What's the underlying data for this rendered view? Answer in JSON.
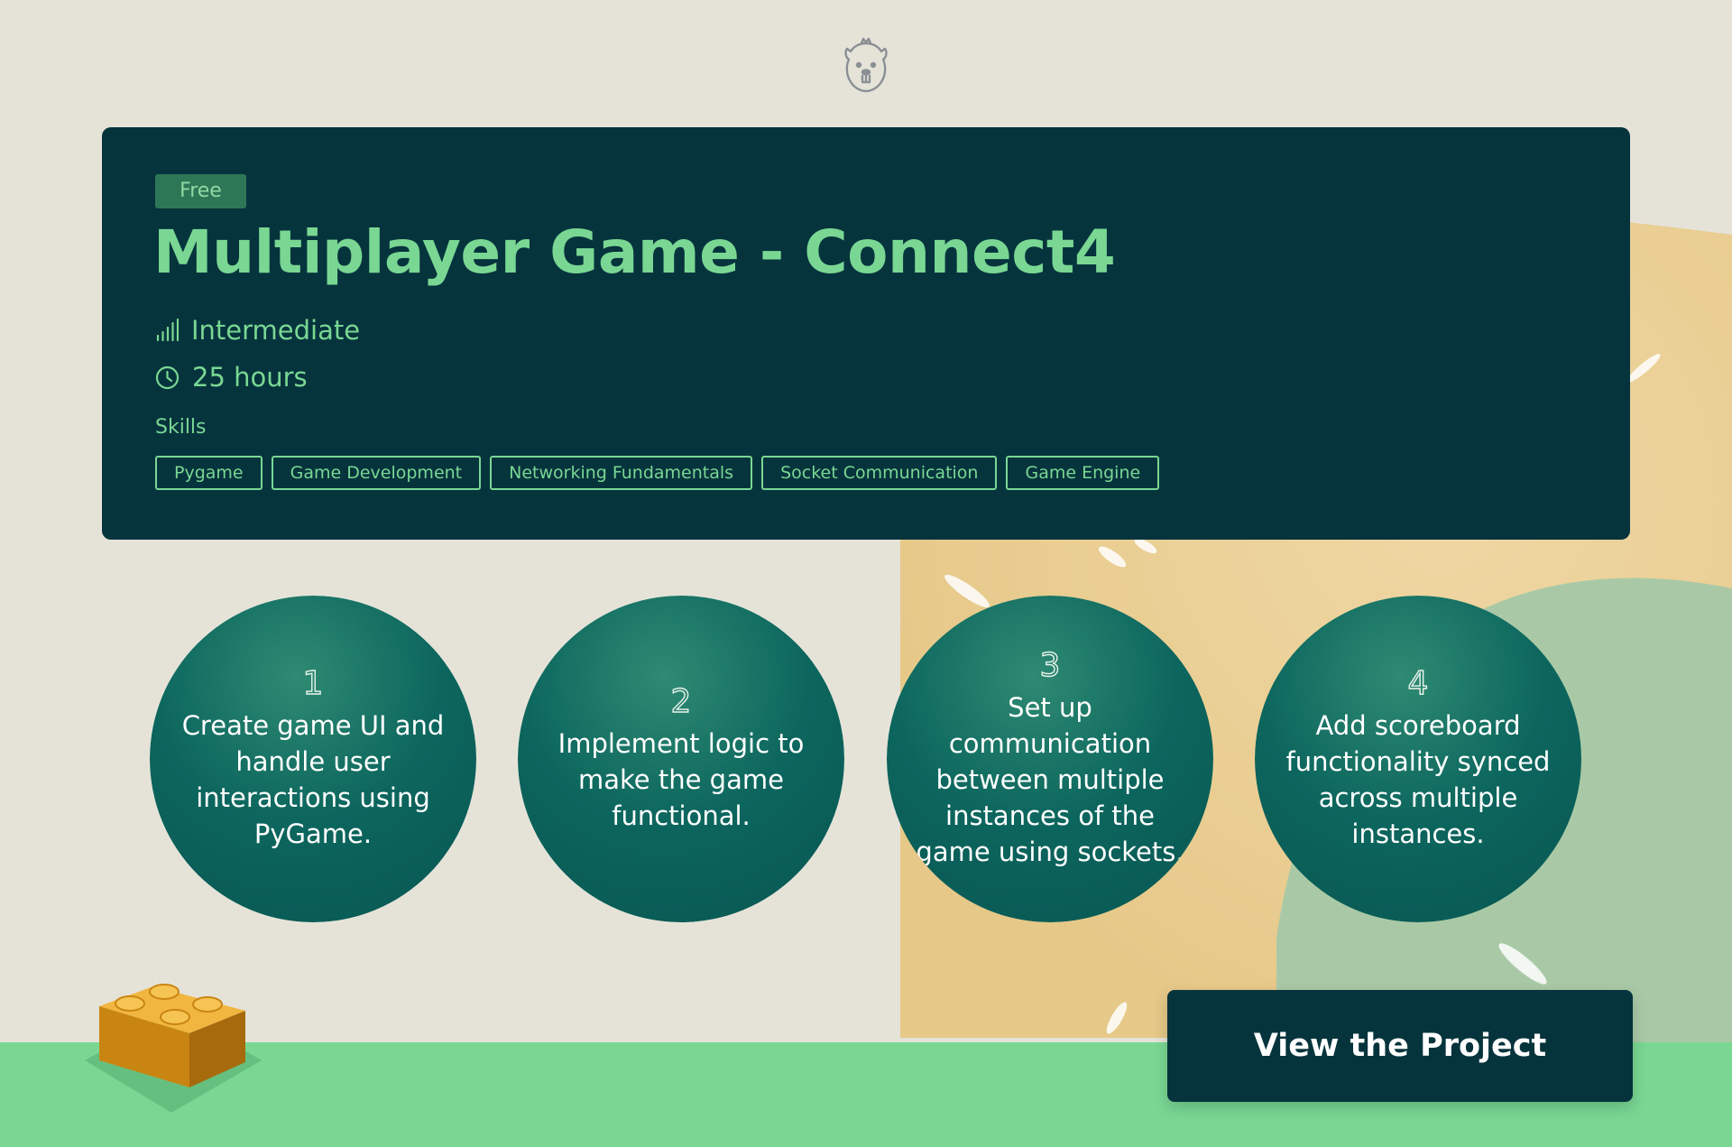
{
  "badge": "Free",
  "title": "Multiplayer Game - Connect4",
  "level": {
    "icon": "signal-bars-icon",
    "label": "Intermediate"
  },
  "duration": {
    "icon": "clock-icon",
    "label": "25 hours"
  },
  "skills_heading": "Skills",
  "skills": [
    "Pygame",
    "Game Development",
    "Networking Fundamentals",
    "Socket Communication",
    "Game Engine"
  ],
  "steps": [
    {
      "number": "1",
      "text": "Create game UI and handle user interactions using PyGame."
    },
    {
      "number": "2",
      "text": "Implement logic to make the game functional."
    },
    {
      "number": "3",
      "text": "Set up communication between multiple instances of the game using sockets."
    },
    {
      "number": "4",
      "text": "Add scoreboard functionality synced across multiple instances."
    }
  ],
  "cta_label": "View the Project",
  "icons": {
    "logo": "beaver-logo-icon",
    "decoration": "toy-brick-icon"
  },
  "colors": {
    "page_background": "#e5e3d8",
    "card_background": "#06343d",
    "accent_green": "#79d793",
    "badge_background": "#2e7756",
    "step_circle": "#0c665e",
    "bottom_band": "#79d793",
    "sand_blob": "#e9cf97",
    "sage_blob": "#a9c9a6",
    "cta_text": "#ffffff"
  }
}
